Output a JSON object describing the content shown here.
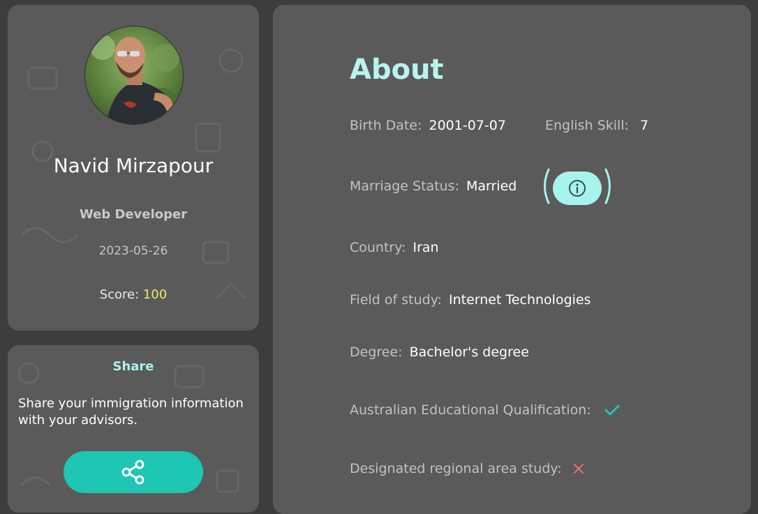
{
  "profile": {
    "name": "Navid Mirzapour",
    "role": "Web Developer",
    "date": "2023-05-26",
    "score_label": "Score:",
    "score_value": "100"
  },
  "share": {
    "title": "Share",
    "text": "Share your immigration information with your advisors.",
    "button_icon": "share-icon"
  },
  "about": {
    "title": "About",
    "birth_date_label": "Birth Date:",
    "birth_date_value": "2001-07-07",
    "english_skill_label": "English Skill:",
    "english_skill_value": "7",
    "marriage_label": "Marriage Status:",
    "marriage_value": "Married",
    "info_icon": "info-icon",
    "country_label": "Country:",
    "country_value": "Iran",
    "field_label": "Field of study:",
    "field_value": "Internet Technologies",
    "degree_label": "Degree:",
    "degree_value": "Bachelor's degree",
    "aus_qual_label": "Australian Educational Qualification:",
    "aus_qual_icon": "check-icon",
    "regional_label": "Designated regional area study:",
    "regional_icon": "cross-icon"
  },
  "colors": {
    "card_bg": "#5a5a5a",
    "page_bg": "#3d3d3d",
    "accent_teal": "#1ec6b3",
    "accent_light": "#a7f3ee",
    "score_yellow": "#f2e27a",
    "check_color": "#1ec6b3",
    "cross_color": "#e57373"
  }
}
